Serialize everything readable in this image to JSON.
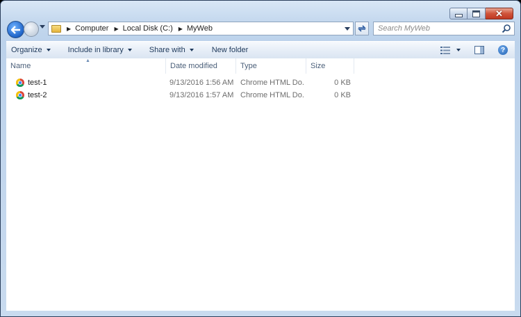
{
  "window": {
    "caption_buttons": [
      "minimize-icon",
      "maximize-icon",
      "close-icon"
    ],
    "close_glyph": "✕"
  },
  "address": {
    "crumbs": [
      "Computer",
      "Local Disk (C:)",
      "MyWeb"
    ],
    "separator": "▶"
  },
  "search": {
    "placeholder": "Search MyWeb"
  },
  "toolbar": {
    "organize": "Organize",
    "include_in_library": "Include in library",
    "share_with": "Share with",
    "new_folder": "New folder"
  },
  "columns": {
    "name": "Name",
    "date_modified": "Date modified",
    "type": "Type",
    "size": "Size"
  },
  "files": [
    {
      "name": "test-1",
      "date": "9/13/2016 1:56 AM",
      "type": "Chrome HTML Do...",
      "size": "0 KB",
      "icon": "chrome-icon"
    },
    {
      "name": "test-2",
      "date": "9/13/2016 1:57 AM",
      "type": "Chrome HTML Do...",
      "size": "0 KB",
      "icon": "chrome-icon"
    }
  ],
  "colors": {
    "chrome_red": "#db4437",
    "chrome_yellow": "#f4c20d",
    "chrome_green": "#0f9d58",
    "chrome_blue": "#4285f4",
    "close_red": "#c03822"
  },
  "help_glyph": "?"
}
